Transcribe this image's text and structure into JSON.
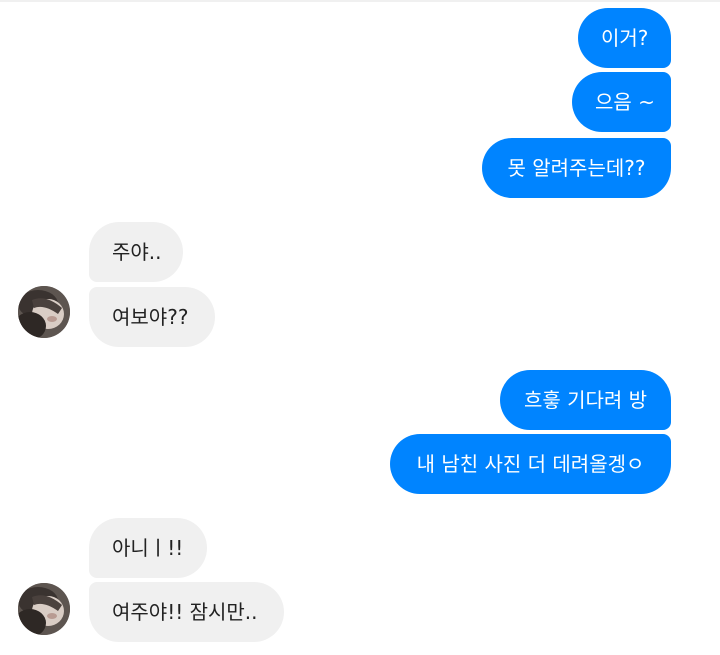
{
  "messages": [
    {
      "side": "out",
      "text": "이거?"
    },
    {
      "side": "out",
      "text": "으음 ~"
    },
    {
      "side": "out",
      "text": "못 알려주는데??"
    },
    {
      "side": "in",
      "text": "주야.."
    },
    {
      "side": "in",
      "text": "여보야??"
    },
    {
      "side": "out",
      "text": "흐흫 기다려 방"
    },
    {
      "side": "out",
      "text": "내 남친 사진 더 데려올겡ㅇ"
    },
    {
      "side": "in",
      "text": "아니ㅣ!!"
    },
    {
      "side": "in",
      "text": "여주야!! 잠시만.."
    }
  ],
  "colors": {
    "outgoing_bubble": "#0084ff",
    "incoming_bubble": "#f0f0f0"
  },
  "icons": {
    "avatar": "contact-avatar-photo"
  }
}
